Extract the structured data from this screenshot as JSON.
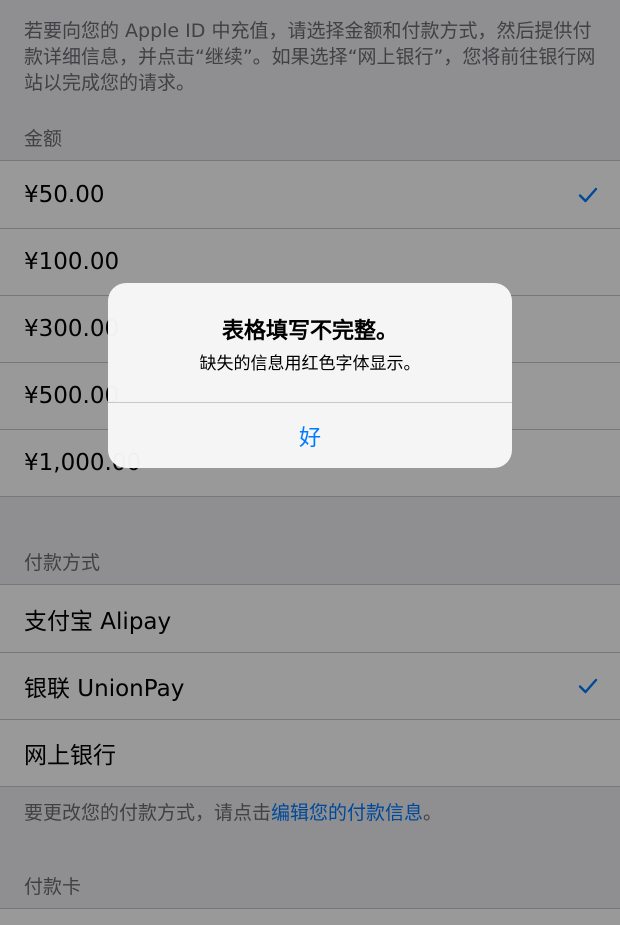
{
  "intro_text": "若要向您的 Apple ID 中充值，请选择金额和付款方式，然后提供付款详细信息，并点击“继续”。如果选择“网上银行”，您将前往银行网站以完成您的请求。",
  "amount_section": {
    "header": "金额",
    "items": [
      {
        "label": "¥50.00",
        "selected": true
      },
      {
        "label": "¥100.00",
        "selected": false
      },
      {
        "label": "¥300.00",
        "selected": false
      },
      {
        "label": "¥500.00",
        "selected": false
      },
      {
        "label": "¥1,000.00",
        "selected": false
      }
    ]
  },
  "payment_section": {
    "header": "付款方式",
    "items": [
      {
        "label": "支付宝 Alipay",
        "selected": false
      },
      {
        "label": "银联 UnionPay",
        "selected": true
      },
      {
        "label": "网上银行",
        "selected": false
      }
    ],
    "footer_prefix": "要更改您的付款方式，请点击",
    "footer_link": "编辑您的付款信息",
    "footer_suffix": "。"
  },
  "card_section": {
    "header": "付款卡"
  },
  "alert": {
    "title": "表格填写不完整。",
    "message": "缺失的信息用红色字体显示。",
    "button_label": "好"
  },
  "colors": {
    "accent": "#007aff",
    "secondary_text": "#6d6d72",
    "background": "#efeff4",
    "separator": "#c8c7cc"
  },
  "icons": {
    "selected_marker": "checkmark-icon"
  }
}
